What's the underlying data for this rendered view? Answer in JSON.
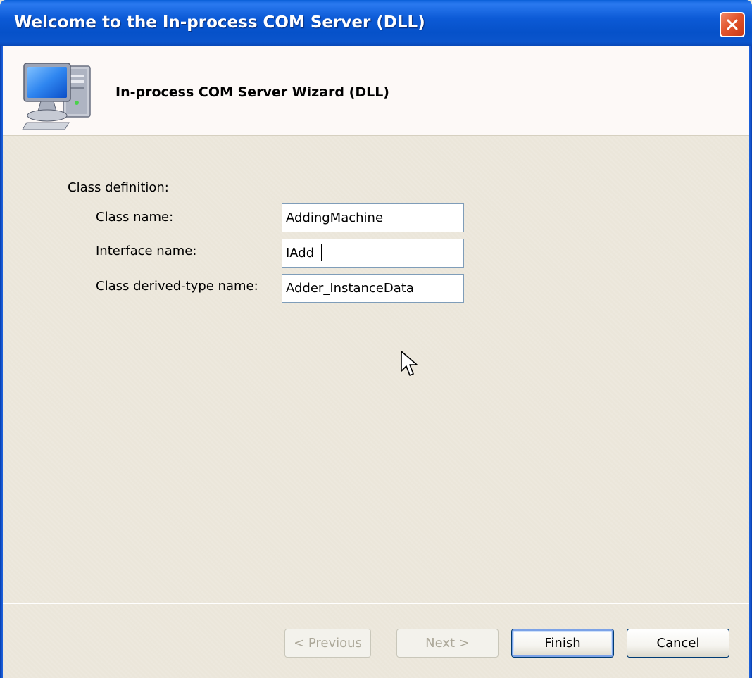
{
  "window": {
    "title": "Welcome to the In-process COM Server (DLL)"
  },
  "header": {
    "title": "In-process COM Server Wizard (DLL)",
    "icon": "computer-icon"
  },
  "form": {
    "section_label": "Class definition:",
    "class_name_label": "Class name:",
    "class_name_value": "AddingMachine",
    "interface_name_label": "Interface name:",
    "interface_name_value": "IAdd",
    "derived_type_label": "Class derived-type name:",
    "derived_type_value": "Adder_InstanceData"
  },
  "buttons": {
    "previous": "< Previous",
    "next": "Next >",
    "finish": "Finish",
    "cancel": "Cancel"
  },
  "colors": {
    "titlebar": "#0651c9",
    "close": "#e2552c",
    "body": "#ebe6da"
  }
}
